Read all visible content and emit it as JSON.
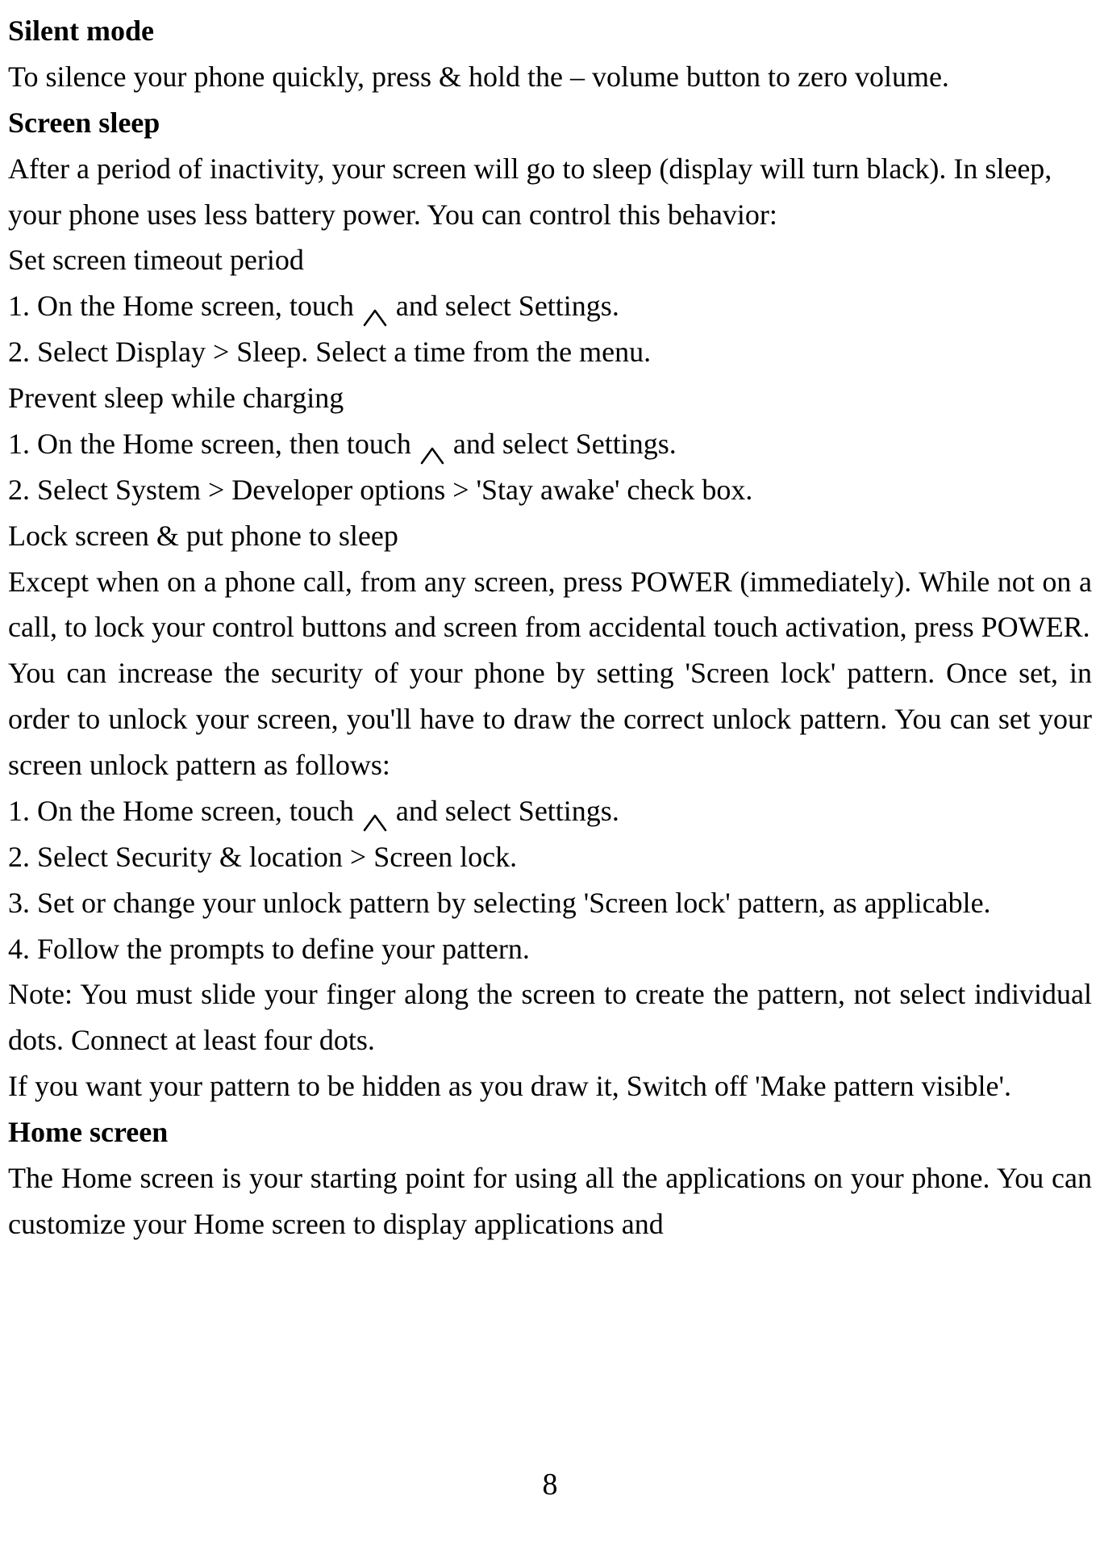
{
  "sections": {
    "silentMode": {
      "heading": "Silent mode",
      "body": "To silence your phone quickly, press & hold the – volume button to zero volume."
    },
    "screenSleep": {
      "heading": "Screen sleep",
      "intro": "After a period of inactivity, your screen will go to sleep (display will turn black). In sleep, your phone uses less battery power. You can control this behavior:",
      "setTimeoutHeading": "Set screen timeout period",
      "step1a": "1. On the Home screen, touch ",
      "step1b": " and select Settings.",
      "step2": "2. Select Display > Sleep. Select a time from the menu.",
      "preventHeading": "Prevent sleep while charging",
      "pstep1a": "1. On the Home screen, then touch ",
      "pstep1b": " and select Settings.",
      "pstep2": "2. Select System > Developer options > 'Stay awake' check box.",
      "lockHeading": "Lock screen & put phone to sleep",
      "lockBody1": "Except when on a phone call, from any screen, press POWER (immediately). While not on a call, to lock your control buttons and screen from accidental touch activation, press POWER.",
      "lockBody2": "You can increase the security of your phone by setting 'Screen lock' pattern. Once set, in order to unlock your screen, you'll have to draw the correct unlock pattern. You can set your screen unlock pattern as follows:",
      "lstep1a": "1. On the Home screen, touch ",
      "lstep1b": " and select Settings.",
      "lstep2": "2. Select Security & location > Screen lock.",
      "lstep3": "3. Set or change your unlock pattern by selecting 'Screen lock' pattern, as applicable.",
      "lstep4": "4. Follow the prompts to define your pattern.",
      "note": "Note: You must slide your finger along the screen to create the pattern, not select individual dots. Connect at least four dots.",
      "hidden": "If you want your pattern to be hidden as you draw it, Switch off   'Make pattern visible'."
    },
    "homeScreen": {
      "heading": "Home screen",
      "body": "The Home screen is your starting point for using all the applications on your phone. You can customize your Home screen to display applications and"
    }
  },
  "pageNumber": "8"
}
